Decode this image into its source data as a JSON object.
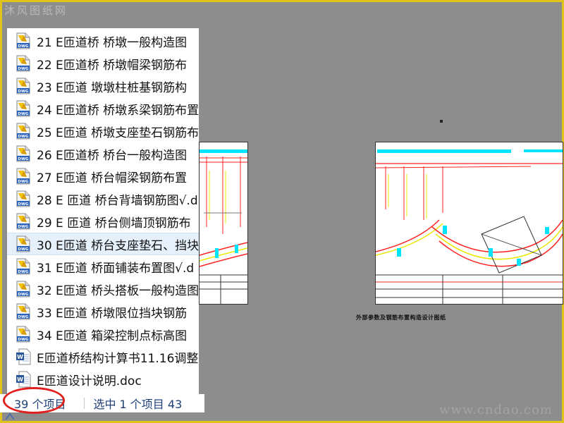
{
  "watermark": {
    "top": "沐风图纸网",
    "bottom": "www.cndao.com"
  },
  "files": [
    {
      "name": "21  E匝道桥  桥墩一般构造图",
      "icon": "dwg-file-icon"
    },
    {
      "name": "22  E匝道桥   桥墩帽梁钢筋布",
      "icon": "dwg-file-icon"
    },
    {
      "name": "23  E匝道  墩墩柱桩基钢筋构",
      "icon": "dwg-file-icon"
    },
    {
      "name": "24 E匝道桥 桥墩系梁钢筋布置",
      "icon": "dwg-file-icon"
    },
    {
      "name": "25  E匝道 桥墩支座垫石钢筋布",
      "icon": "dwg-file-icon"
    },
    {
      "name": "26  E匝道桥  桥台一般构造图",
      "icon": "dwg-file-icon"
    },
    {
      "name": "27  E匝道 桥台帽梁钢筋布置",
      "icon": "dwg-file-icon"
    },
    {
      "name": "28 E 匝道 桥台背墙钢筋图√.d",
      "icon": "dwg-file-icon"
    },
    {
      "name": "29 E 匝道 桥台侧墙顶钢筋布",
      "icon": "dwg-file-icon"
    },
    {
      "name": "30 E匝道 桥台支座垫石、挡块",
      "icon": "dwg-file-icon",
      "selected": true
    },
    {
      "name": "31 E匝道 桥面铺装布置图√.d",
      "icon": "dwg-file-icon"
    },
    {
      "name": "32  E匝道 桥头搭板一般构造图",
      "icon": "dwg-file-icon"
    },
    {
      "name": "33  E匝道  桥墩限位挡块钢筋",
      "icon": "dwg-file-icon"
    },
    {
      "name": "34  E匝道  箱梁控制点标高图",
      "icon": "dwg-file-icon"
    },
    {
      "name": "E匝道桥结构计算书11.16调整",
      "icon": "word-doc-icon"
    },
    {
      "name": "E匝道设计说明.doc",
      "icon": "word-doc-icon"
    }
  ],
  "status": {
    "item_count": "39 个项目",
    "selection": "选中 1 个项目  43"
  },
  "cad": {
    "caption": "外部参数及钢筋布置构造设计图纸"
  },
  "colors": {
    "background": "#8d8d8d",
    "frame": "#e0c31b",
    "selection": "#e5f0fb",
    "status_text": "#1e3f78",
    "highlight_ellipse": "#e0211d"
  }
}
